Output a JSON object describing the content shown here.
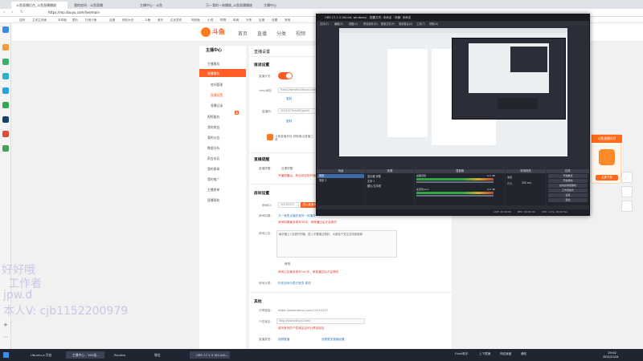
{
  "browser": {
    "tabs": [
      "斗鱼直播后台_斗鱼直播播放",
      "我的房间 - 斗鱼直播",
      "主播中心 - 斗鱼",
      "万一我的一体播放_斗鱼直播播放",
      "主播中心"
    ],
    "url": "https://mp.douyu.com/live/main",
    "bookmarks": [
      "百科",
      "主页主页面",
      "手机版",
      "图片",
      "抖音斗鱼",
      "百度",
      "网站大全",
      "斗鱼",
      "音乐",
      "企业发布",
      "网页版",
      "小说",
      "购物",
      "电商",
      "头条",
      "百度",
      "设置",
      "其他"
    ]
  },
  "site": {
    "logo": "斗鱼",
    "nav": [
      "首页",
      "直播",
      "分类",
      "视频"
    ],
    "menu": {
      "title": "主播中心",
      "items": [
        "主播服务",
        "直播服务",
        "房间管理",
        "直播设置",
        "直播记录",
        "视频服务",
        "我的收益",
        "我的公会",
        "数据分析",
        "帮会成员",
        "我的星球",
        "我的推广",
        "主播榜单",
        "直播帮助"
      ],
      "badge": "新"
    },
    "content": {
      "title": "直播设置",
      "push_section": "推流设置",
      "live_switch_label": "直播开关:",
      "rtmp_label": "rtmp地址:",
      "rtmp_value": "rtmp://sendfc3.douyu.com/live",
      "copy": "复制",
      "stream_code_label": "直播码:",
      "stream_code_value": "1011227rmvXQgwLb",
      "copy2": "复制",
      "tool_text": "斗鱼直播伴侣 获取最近直播工具",
      "reminder_section": "直播提醒",
      "reminder_label": "直播提醒:",
      "reminder_value": "设置提醒",
      "reminder_hint": "开播提醒后，粉丝将收到开播通知",
      "room_section": "房间设置",
      "room_id_label": "房间ID:",
      "room_id_value": "10131227",
      "room_id_btn": "进入直播间",
      "room_name_label": "房间标题:",
      "room_name_value": "万一我的点播扶我的一体播放",
      "room_name_hint": "房间标题最多填写30字，审核通过后才会修改",
      "room_notice_label": "房间公告:",
      "room_notice_value": "每天晚上7点准时开播，进入不要错过精彩，大家给个关注支持我谢谢",
      "room_notice_btn": "修改",
      "room_notice_hint": "房间公告最多填写100字，审核通过后才会修改",
      "room_cover_label": "房间分类:",
      "room_cover_value": "你还没有分类已登录 修改",
      "other_section": "其他",
      "share_label": "分享链接:",
      "share_value": "https://www.douyu.com/10131227",
      "bind_label": "个性域名:",
      "bind_value": "http://www.douyu.com/",
      "bind_hint": "填写有效的个性域名后可分享给朋友",
      "live_type_label": "直播类型:",
      "live_type_value": "视频直播",
      "bottom_link": "查看更多直播设置"
    },
    "promo": {
      "title": "斗鱼直播伴侣",
      "btn": "立即下载"
    }
  },
  "obs": {
    "title": "OBS 27.1.3 (64-bit, windows) - 配置文件: 未命名 - 场景: 未命名",
    "menu": [
      "文件(F)",
      "编辑(E)",
      "视图(V)",
      "停靠部件(D)",
      "配置文件(P)",
      "场景集合(S)",
      "工具(T)",
      "帮助(H)"
    ],
    "panels": [
      "场景",
      "来源",
      "混音器",
      "转场特效",
      "控件"
    ],
    "scenes": [
      "场景",
      "场景 2"
    ],
    "sources": [
      "显示器 采集",
      "文本 1",
      "图片/文本框"
    ],
    "mixer": [
      {
        "name": "桌面音频",
        "db": "0.0 dB"
      },
      {
        "name": "麦克风/Aux",
        "db": "0.0 dB"
      }
    ],
    "transition": {
      "type": "淡出",
      "duration_label": "时长",
      "duration": "300 ms"
    },
    "controls": [
      "开始推流",
      "开始录制",
      "启动虚拟摄像机",
      "工作室模式",
      "设置",
      "退出"
    ],
    "status": {
      "live": "LIVE: 00:00:00",
      "rec": "REC: 00:00:00",
      "cpu": "CPU: 1.1%, 30.00 fps"
    }
  },
  "watermark": {
    "line1": "好好哦",
    "line2": "工作者",
    "line3": "jpw.d",
    "line4": "本人V: cjb1152200979"
  },
  "taskbar": {
    "items": [
      "Ubuntu-a 开启",
      "主播中心 - 360极...",
      "Recaba",
      "微信",
      "OBS 27.1.3 (64-bit)..."
    ],
    "tray": [
      "Flash助手",
      "上下载速",
      "响应速度",
      "通知"
    ],
    "time": "19:02",
    "date": "2021/11/24"
  },
  "colors": {
    "accent": "#ff5d23",
    "obs_bg": "#2b2e38",
    "taskbar": "#1f2531"
  }
}
